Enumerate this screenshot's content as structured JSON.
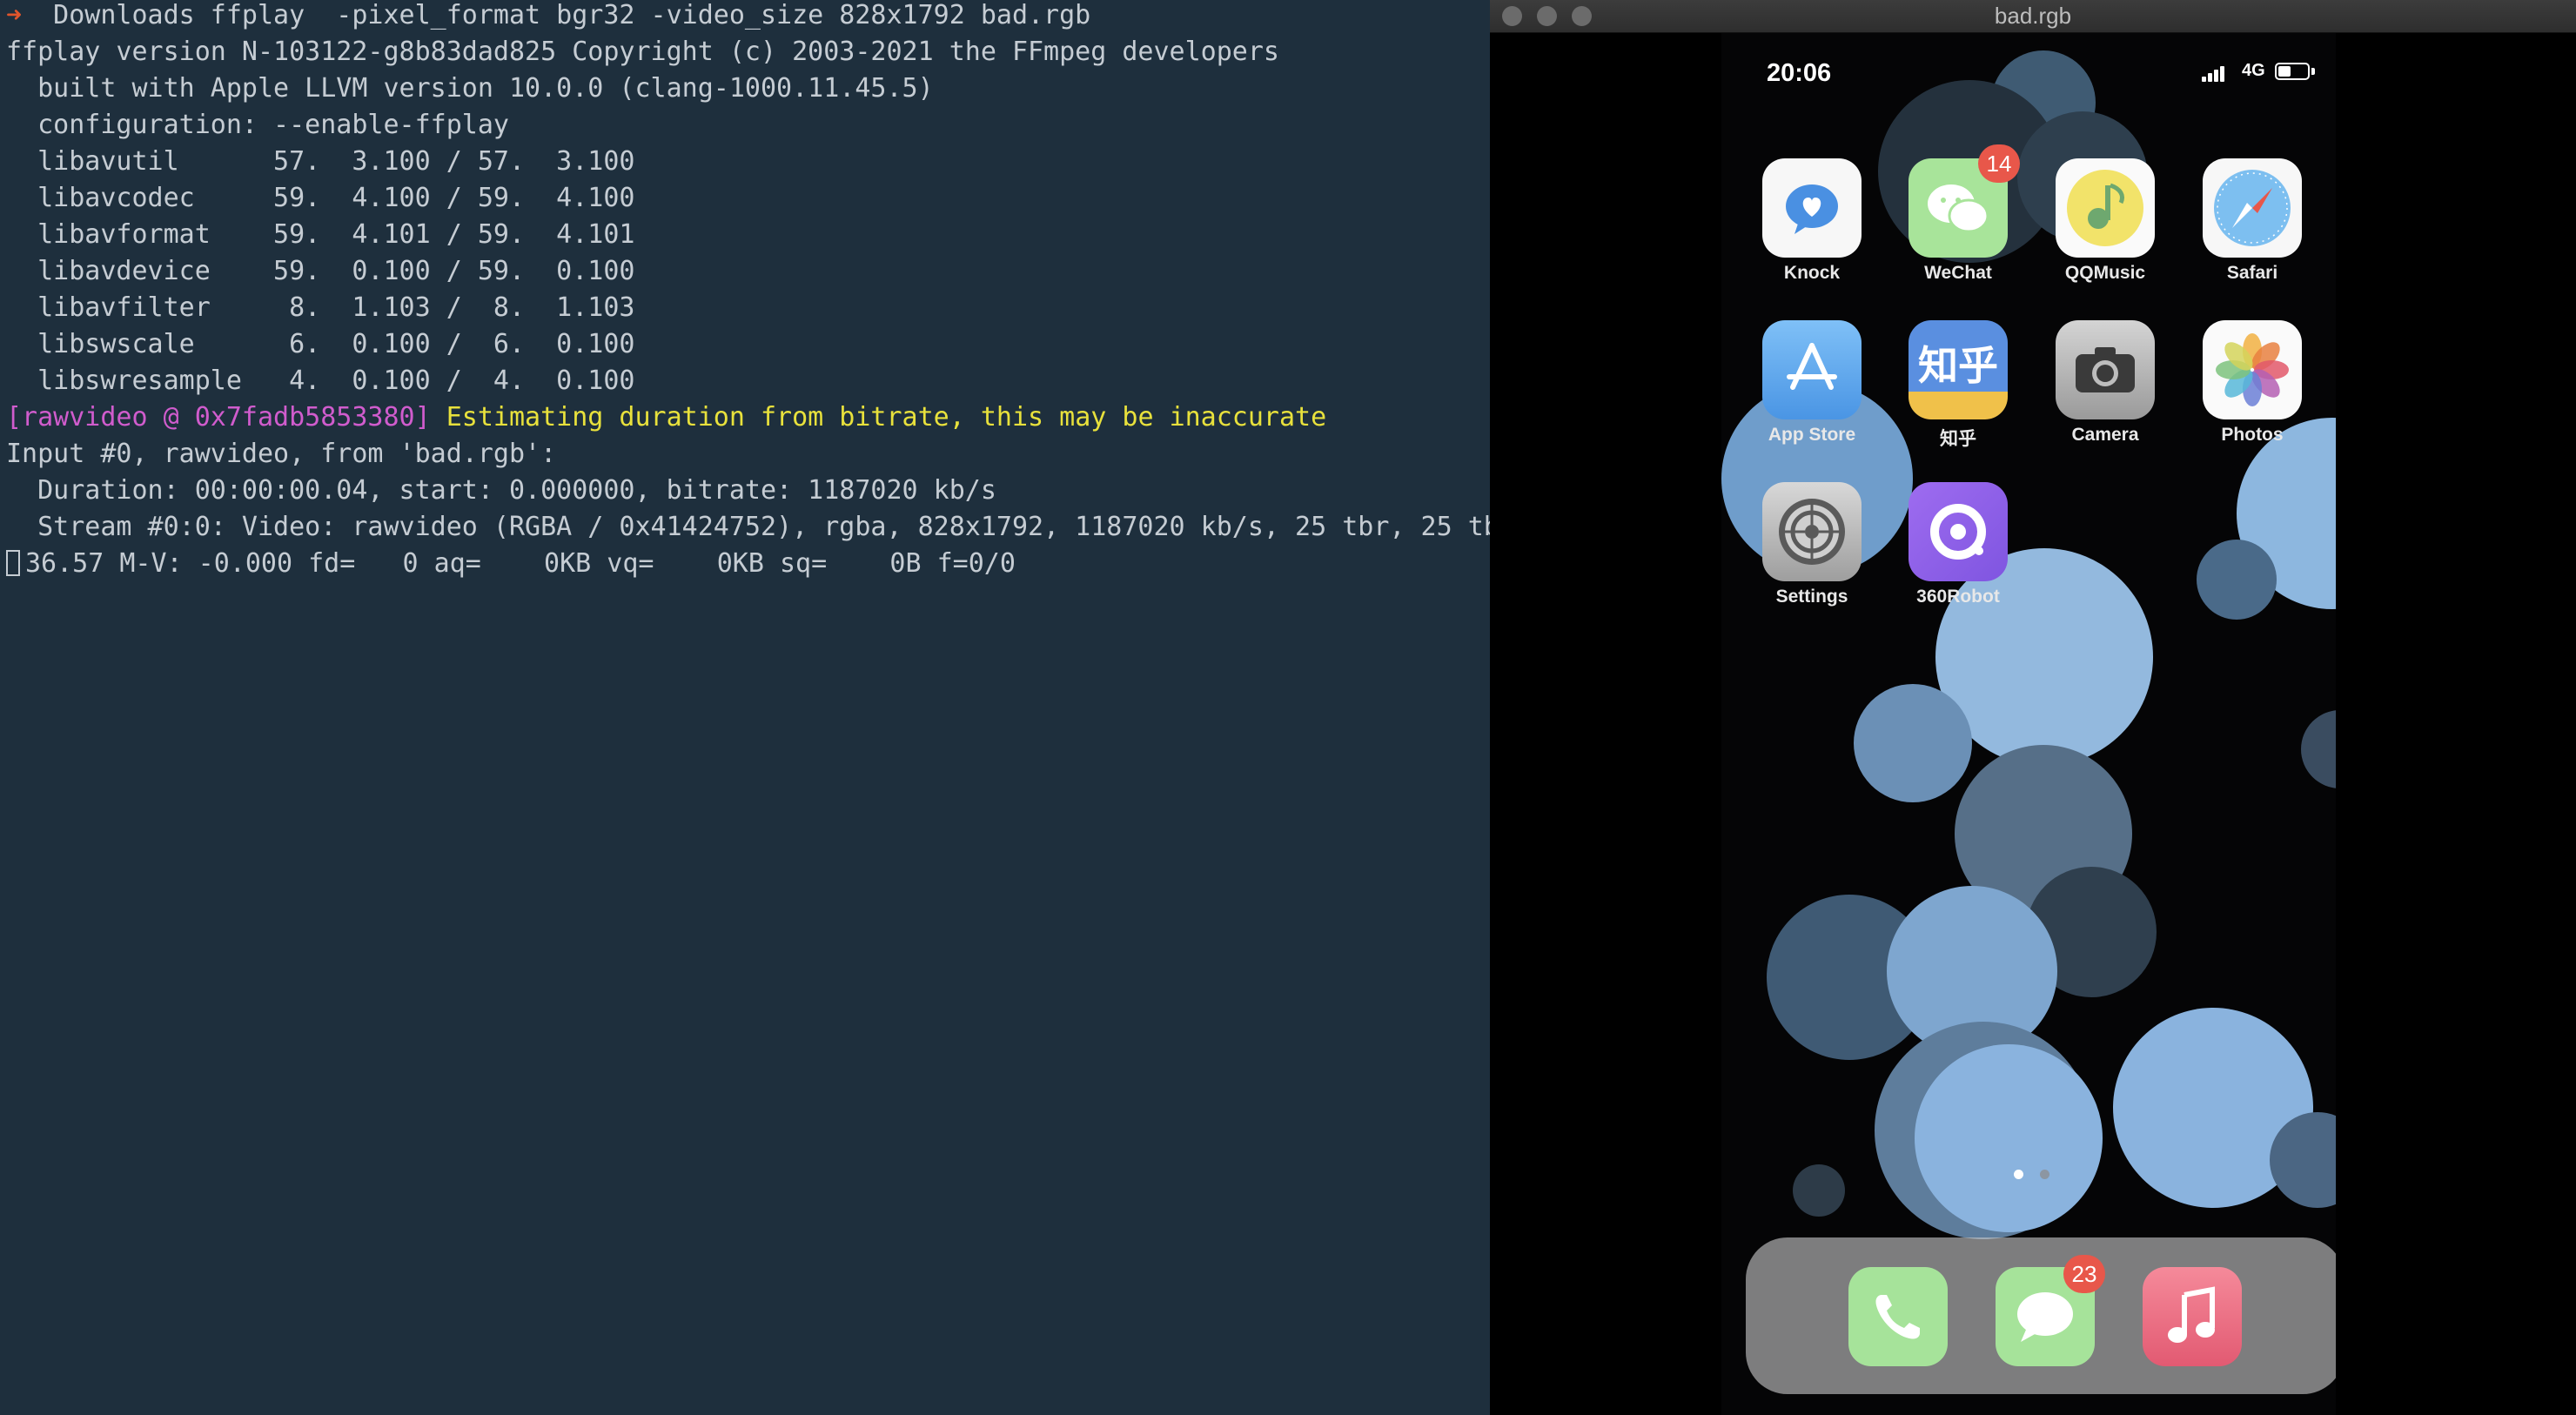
{
  "terminal": {
    "prompt_arrow": "➜",
    "command": "  Downloads ffplay  -pixel_format bgr32 -video_size 828x1792 bad.rgb",
    "lines": [
      "ffplay version N-103122-g8b83dad825 Copyright (c) 2003-2021 the FFmpeg developers",
      "  built with Apple LLVM version 10.0.0 (clang-1000.11.45.5)",
      "  configuration: --enable-ffplay",
      "  libavutil      57.  3.100 / 57.  3.100",
      "  libavcodec     59.  4.100 / 59.  4.100",
      "  libavformat    59.  4.101 / 59.  4.101",
      "  libavdevice    59.  0.100 / 59.  0.100",
      "  libavfilter     8.  1.103 /  8.  1.103",
      "  libswscale      6.  0.100 /  6.  0.100",
      "  libswresample   4.  0.100 /  4.  0.100"
    ],
    "warn_prefix": "[rawvideo @ 0x7fadb5853380]",
    "warn_text": " Estimating duration from bitrate, this may be inaccurate",
    "input_lines": [
      "Input #0, rawvideo, from 'bad.rgb':",
      "  Duration: 00:00:00.04, start: 0.000000, bitrate: 1187020 kb/s",
      "  Stream #0:0: Video: rawvideo (RGBA / 0x41424752), rgba, 828x1792, 1187020 kb/s, 25 tbr, 25 tb"
    ],
    "status": "36.57 M-V: -0.000 fd=   0 aq=    0KB vq=    0KB sq=    0B f=0/0"
  },
  "window": {
    "title": "bad.rgb"
  },
  "phone": {
    "time": "20:06",
    "carrier": "4G",
    "apps": [
      {
        "label": "Knock",
        "icon": "knock-icon"
      },
      {
        "label": "WeChat",
        "icon": "wechat-icon",
        "badge": "14"
      },
      {
        "label": "QQMusic",
        "icon": "qqmusic-icon"
      },
      {
        "label": "Safari",
        "icon": "safari-icon"
      },
      {
        "label": "App Store",
        "icon": "app-store-icon"
      },
      {
        "label": "知乎",
        "icon": "zhihu-icon",
        "glyph": "知乎"
      },
      {
        "label": "Camera",
        "icon": "camera-icon"
      },
      {
        "label": "Photos",
        "icon": "photos-icon"
      },
      {
        "label": "Settings",
        "icon": "settings-icon"
      },
      {
        "label": "360Robot",
        "icon": "robot-icon"
      }
    ],
    "dock": [
      {
        "icon": "phone-icon"
      },
      {
        "icon": "messages-icon",
        "badge": "23"
      },
      {
        "icon": "music-icon"
      }
    ]
  }
}
